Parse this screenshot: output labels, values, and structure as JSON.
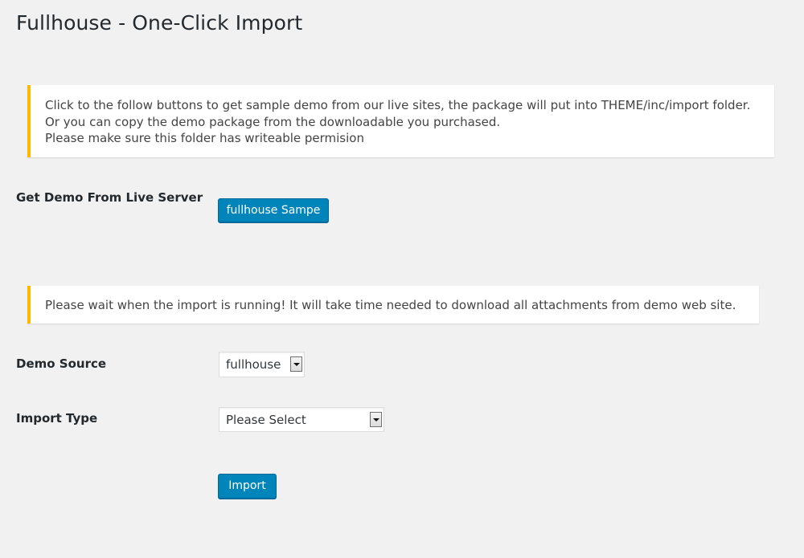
{
  "page": {
    "title": "Fullhouse - One-Click Import"
  },
  "notice_info": {
    "lines": [
      "Click to the follow buttons to get sample demo from our live sites, the package will put into THEME/inc/import folder.",
      "Or you can copy the demo package from the downloadable you purchased.",
      "Please make sure this folder has writeable permision"
    ]
  },
  "live_server": {
    "label": "Get Demo From Live Server",
    "button_label": "fullhouse Sampe"
  },
  "notice_wait": {
    "text": "Please wait when the import is running! It will take time needed to download all attachments from demo web site."
  },
  "demo_source": {
    "label": "Demo Source",
    "selected": "fullhouse",
    "icon": "chevron-down-icon"
  },
  "import_type": {
    "label": "Import Type",
    "selected": "Please Select",
    "icon": "chevron-down-icon"
  },
  "import_button": {
    "label": "Import"
  },
  "colors": {
    "background": "#f1f1f1",
    "notice_border": "#ffb900",
    "button_primary": "#0085ba"
  }
}
